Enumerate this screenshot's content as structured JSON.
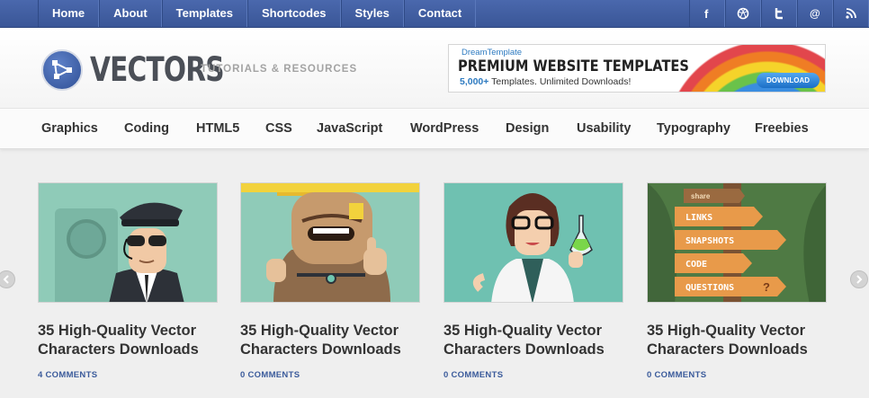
{
  "topnav": {
    "items": [
      "Home",
      "About",
      "Templates",
      "Shortcodes",
      "Styles",
      "Contact"
    ],
    "social": [
      {
        "icon": "facebook-icon",
        "glyph": "f"
      },
      {
        "icon": "dribbble-icon",
        "glyph": "⊛"
      },
      {
        "icon": "twitter-icon",
        "glyph": "t"
      },
      {
        "icon": "email-icon",
        "glyph": "@"
      },
      {
        "icon": "rss-icon",
        "glyph": "))"
      }
    ]
  },
  "header": {
    "logo_text": "VECTORS",
    "tagline": "TUTORIALS & RESOURCES",
    "banner": {
      "brand": "DreamTemplate",
      "headline": "PREMIUM WEBSITE TEMPLATES",
      "sub_bold": "5,000+",
      "sub_rest": "Templates. Unlimited Downloads!",
      "button": "DOWNLOAD"
    }
  },
  "catnav": {
    "items": [
      "Graphics",
      "Coding",
      "HTML5",
      "CSS",
      "JavaScript",
      "WordPress",
      "Design",
      "Usability",
      "Typography",
      "Freebies"
    ]
  },
  "posts": [
    {
      "title": "35 High-Quality Vector Characters Downloads",
      "comments": "4 COMMENTS"
    },
    {
      "title": "35 High-Quality Vector Characters Downloads",
      "comments": "0 COMMENTS"
    },
    {
      "title": "35 High-Quality Vector Characters Downloads",
      "comments": "0 COMMENTS"
    },
    {
      "title": "35 High-Quality Vector Characters Downloads",
      "comments": "0 COMMENTS"
    }
  ],
  "signpost": {
    "header": "share",
    "signs": [
      "LINKS",
      "SNAPSHOTS",
      "CODE",
      "QUESTIONS"
    ]
  },
  "colors": {
    "topbar": "#3f5ea4",
    "thumb_teal": "#8fcbb8",
    "link_blue": "#3b5b9b"
  }
}
